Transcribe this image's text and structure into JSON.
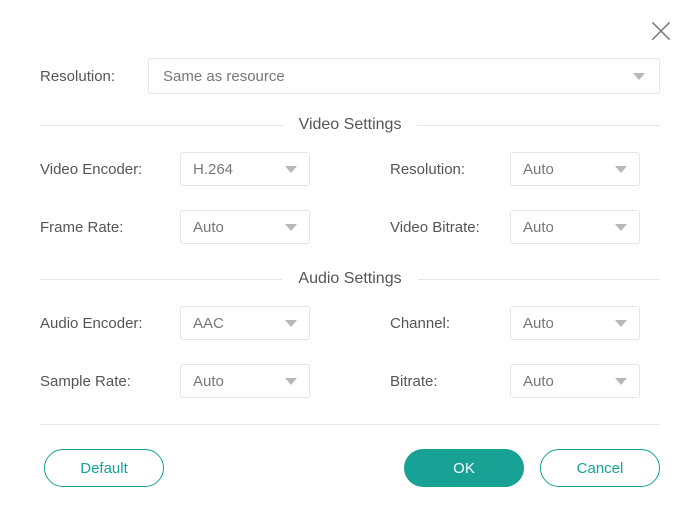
{
  "top": {
    "resolution_label": "Resolution:",
    "resolution_value": "Same as resource"
  },
  "video": {
    "section_title": "Video Settings",
    "encoder_label": "Video Encoder:",
    "encoder_value": "H.264",
    "resolution_label": "Resolution:",
    "resolution_value": "Auto",
    "framerate_label": "Frame Rate:",
    "framerate_value": "Auto",
    "bitrate_label": "Video Bitrate:",
    "bitrate_value": "Auto"
  },
  "audio": {
    "section_title": "Audio Settings",
    "encoder_label": "Audio Encoder:",
    "encoder_value": "AAC",
    "channel_label": "Channel:",
    "channel_value": "Auto",
    "samplerate_label": "Sample Rate:",
    "samplerate_value": "Auto",
    "bitrate_label": "Bitrate:",
    "bitrate_value": "Auto"
  },
  "buttons": {
    "default": "Default",
    "ok": "OK",
    "cancel": "Cancel"
  }
}
